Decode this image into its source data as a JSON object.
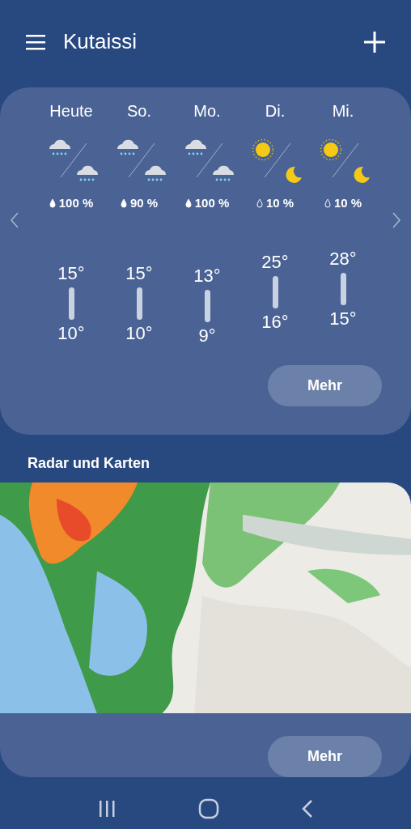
{
  "header": {
    "title": "Kutaissi"
  },
  "forecast": {
    "days": [
      {
        "label": "Heute",
        "kind": "rain",
        "precip": "100 %",
        "high": "15°",
        "low": "10°"
      },
      {
        "label": "So.",
        "kind": "rain",
        "precip": "90 %",
        "high": "15°",
        "low": "10°"
      },
      {
        "label": "Mo.",
        "kind": "rain",
        "precip": "100 %",
        "high": "13°",
        "low": "9°"
      },
      {
        "label": "Di.",
        "kind": "clear",
        "precip": "10 %",
        "high": "25°",
        "low": "16°"
      },
      {
        "label": "Mi.",
        "kind": "clear",
        "precip": "10 %",
        "high": "28°",
        "low": "15°"
      }
    ],
    "more_button": "Mehr"
  },
  "radar": {
    "title": "Radar und Karten",
    "more_button": "Mehr"
  }
}
